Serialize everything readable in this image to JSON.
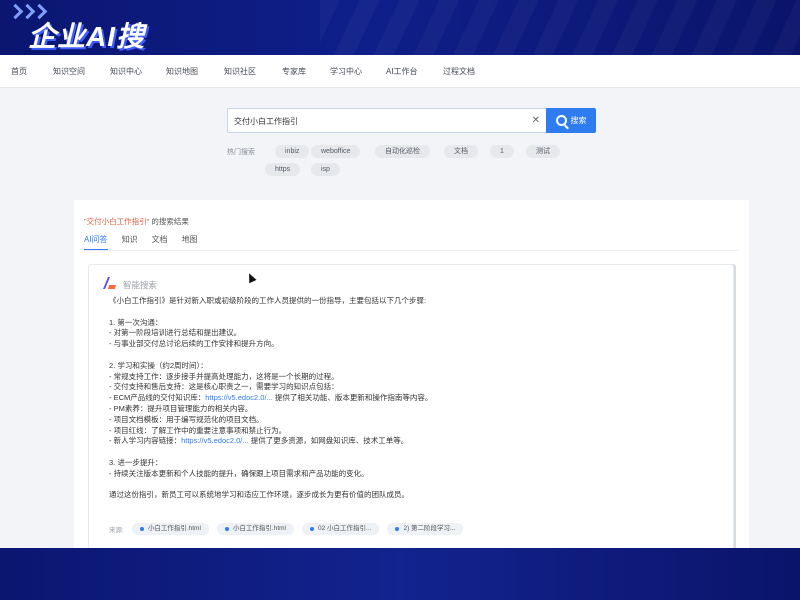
{
  "brand": {
    "title": "企业AI搜"
  },
  "nav": {
    "items": [
      "首页",
      "知识空间",
      "知识中心",
      "知识地图",
      "知识社区",
      "专家库",
      "学习中心",
      "AI工作台",
      "过程文档"
    ]
  },
  "search": {
    "value": "交付小白工作指引",
    "button_label": "搜索",
    "clear_icon": "✕"
  },
  "hot": {
    "label": "热门搜索",
    "tags": [
      "inbiz",
      "weboffice",
      "自动化巡检",
      "文档",
      "1",
      "测试",
      "https",
      "isp"
    ]
  },
  "results": {
    "query": "\"交付小白工作指引\"",
    "suffix": " 的搜索结果",
    "tabs": [
      "AI问答",
      "知识",
      "文档",
      "地图"
    ],
    "active_tab": 0
  },
  "ai": {
    "name": "智能搜索",
    "lines": [
      {
        "t": "《小白工作指引》是针对新入职或初级阶段的工作人员提供的一份指导，主要包括以下几个步骤:"
      },
      {
        "t": ""
      },
      {
        "t": "1. 第一次沟通："
      },
      {
        "t": "- 对第一阶段培训进行总结和提出建议。"
      },
      {
        "t": "- 与事业部交付总讨论后续的工作安排和提升方向。"
      },
      {
        "t": ""
      },
      {
        "t": "2. 学习和实操（约2周时间）："
      },
      {
        "t": "- 常规支持工作：逐步接手并提高处理能力，这将是一个长期的过程。"
      },
      {
        "t": "- 交付支持和售后支持：这是核心职责之一，需要学习的知识点包括："
      },
      {
        "t": "- ECM产品线的交付知识库：",
        "link": "https://v5.edoc2.0/...",
        "after": " 提供了相关功能、版本更新和操作指南等内容。"
      },
      {
        "t": "- PM素养：提升项目管理能力的相关内容。"
      },
      {
        "t": "- 项目文档模板：用于编写规范化的项目文档。"
      },
      {
        "t": "- 项目红线：了解工作中的重要注意事项和禁止行为。"
      },
      {
        "t": "- 新人学习内容链接：",
        "link": "https://v5.edoc2.0/...",
        "after": " 提供了更多资源，如网盘知识库、技术工单等。"
      },
      {
        "t": ""
      },
      {
        "t": "3. 进一步提升："
      },
      {
        "t": "- 持续关注版本更新和个人技能的提升，确保跟上项目需求和产品功能的变化。"
      },
      {
        "t": ""
      },
      {
        "t": "通过这份指引，新员工可以系统地学习和适应工作环境，逐步成长为更有价值的团队成员。"
      }
    ],
    "sources_label": "来源:",
    "sources": [
      "小白工作指引.html",
      "小白工作指引.html",
      "02 小白工作指引...",
      "2) 第二阶段学习..."
    ]
  },
  "colors": {
    "accent": "#2f7bf0",
    "banner": "#0b1660",
    "query": "#e05a3b"
  }
}
